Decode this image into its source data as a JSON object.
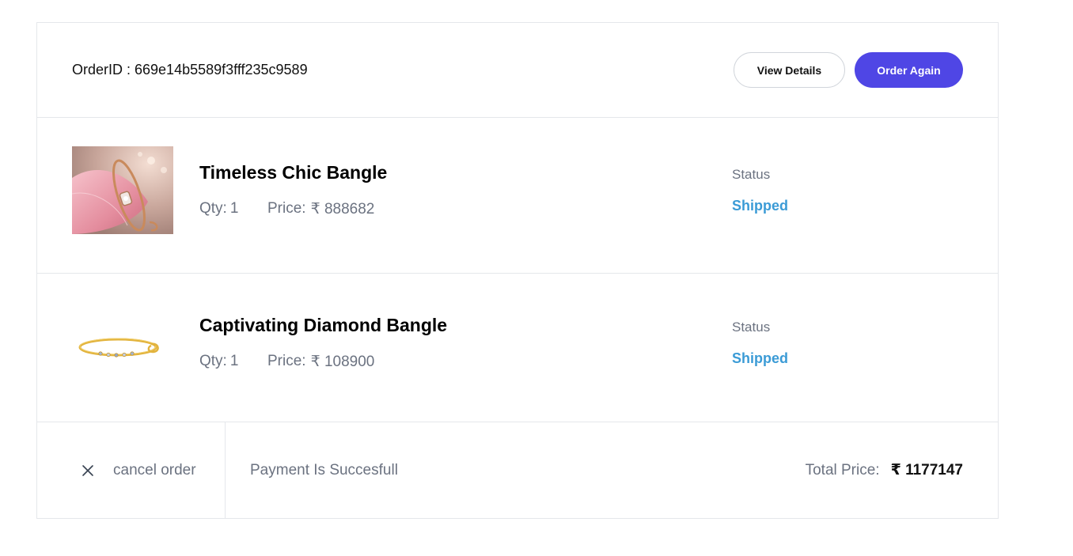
{
  "order": {
    "id_label": "OrderID :",
    "id_value": "669e14b5589f3fff235c9589"
  },
  "actions": {
    "view_details": "View Details",
    "order_again": "Order Again"
  },
  "items": [
    {
      "name": "Timeless Chic Bangle",
      "qty_label": "Qty:",
      "qty": "1",
      "price_label": "Price:",
      "price": "₹ 888682",
      "status_label": "Status",
      "status": "Shipped",
      "image_icon": "rose-gold-bangle-on-pink-petal"
    },
    {
      "name": "Captivating Diamond Bangle",
      "qty_label": "Qty:",
      "qty": "1",
      "price_label": "Price:",
      "price": "₹ 108900",
      "status_label": "Status",
      "status": "Shipped",
      "image_icon": "gold-bangle-with-gems"
    }
  ],
  "footer": {
    "cancel_label": "cancel order",
    "payment_status": "Payment Is Succesfull",
    "total_label": "Total Price:",
    "total_value": "₹ 1177147"
  },
  "colors": {
    "primary": "#4f46e5",
    "status_shipped": "#3b9bd6",
    "border": "#e5e7eb",
    "muted_text": "#6b7280"
  }
}
